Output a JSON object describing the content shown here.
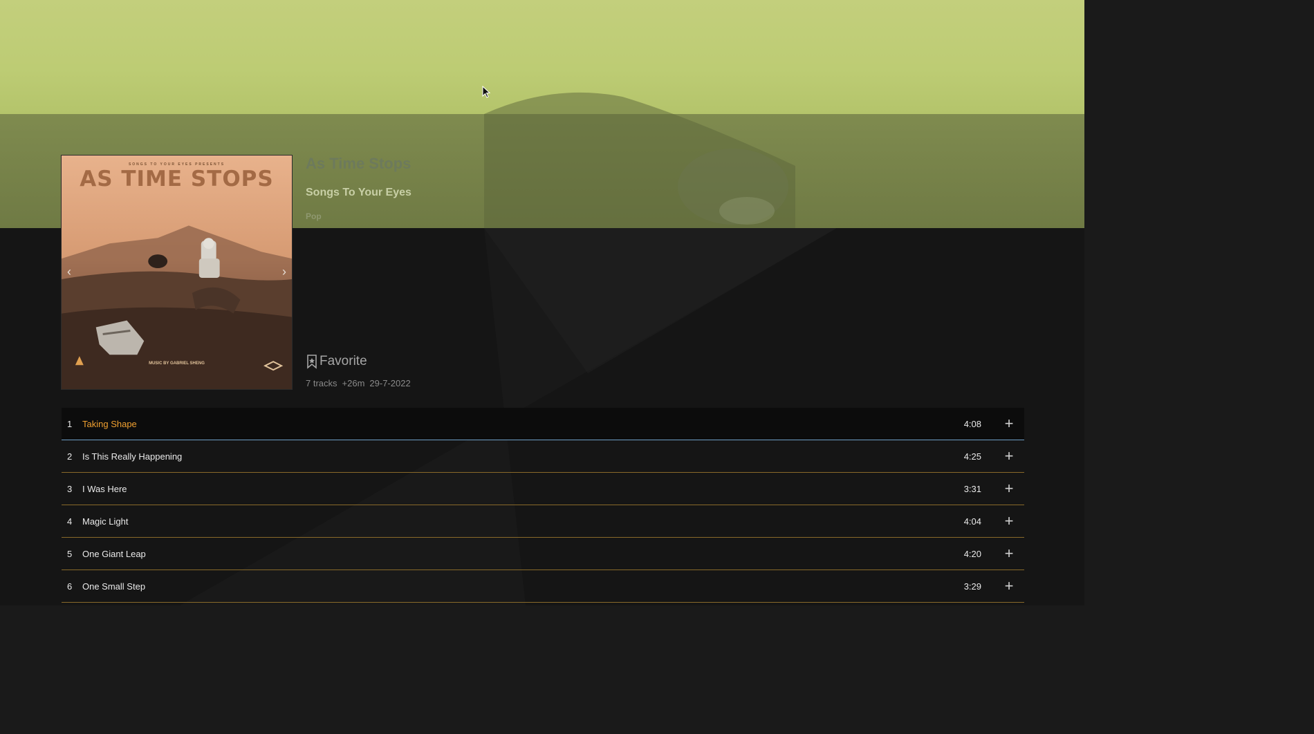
{
  "album": {
    "title": "As Time Stops",
    "artist": "Songs To Your Eyes",
    "genre": "Pop",
    "favorite_label": "Favorite",
    "tracks_count": "7 tracks",
    "duration": "+26m",
    "date": "29-7-2022"
  },
  "cover": {
    "presents": "SONGS TO YOUR EYES PRESENTS",
    "title": "AS TIME STOPS",
    "credit": "MUSIC BY GABRIEL SHENG",
    "prev_icon": "chevron-left-icon",
    "next_icon": "chevron-right-icon"
  },
  "tracks": [
    {
      "num": "1",
      "name": "Taking Shape",
      "duration": "4:08",
      "active": true
    },
    {
      "num": "2",
      "name": "Is This Really Happening",
      "duration": "4:25",
      "active": false
    },
    {
      "num": "3",
      "name": "I Was Here",
      "duration": "3:31",
      "active": false
    },
    {
      "num": "4",
      "name": "Magic Light",
      "duration": "4:04",
      "active": false
    },
    {
      "num": "5",
      "name": "One Giant Leap",
      "duration": "4:20",
      "active": false
    },
    {
      "num": "6",
      "name": "One Small Step",
      "duration": "3:29",
      "active": false
    }
  ],
  "colors": {
    "accent": "#f0a030",
    "active_border": "#6fa0c8",
    "row_border": "#8a6a2a"
  }
}
